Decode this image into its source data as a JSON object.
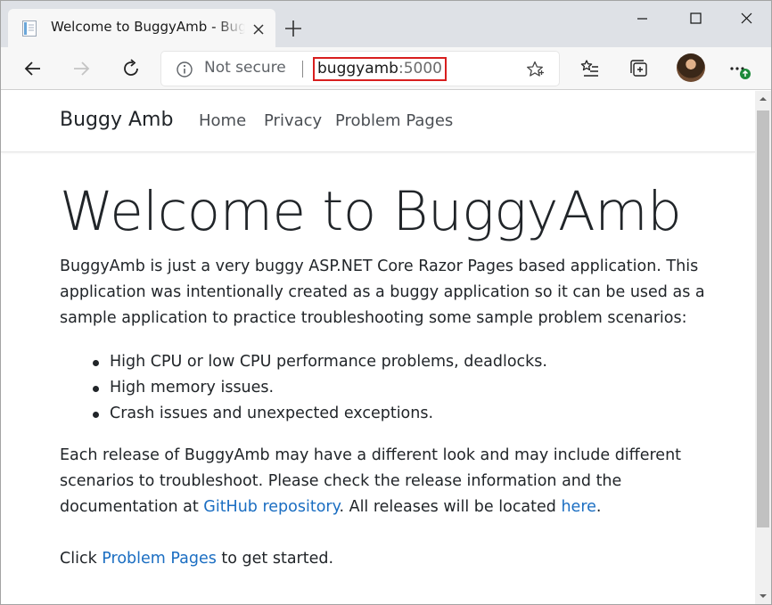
{
  "browser": {
    "tab": {
      "title": "Welcome to BuggyAmb - BuggyAmb"
    },
    "address_bar": {
      "security_label": "Not secure",
      "url_host": "buggyamb",
      "url_port": ":5000"
    },
    "colors": {
      "highlight_box": "#d81e1e",
      "link": "#1b6ec2",
      "update_badge": "#1d8a3a"
    }
  },
  "site": {
    "brand": "Buggy Amb",
    "nav": {
      "home": "Home",
      "privacy": "Privacy",
      "problem_pages": "Problem Pages"
    },
    "hero_title": "Welcome to BuggyAmb",
    "intro": "BuggyAmb is just a very buggy ASP.NET Core Razor Pages based application. This application was intentionally created as a buggy application so it can be used as a sample application to practice troubleshooting some sample problem scenarios:",
    "features": [
      "High CPU or low CPU performance problems, deadlocks.",
      "High memory issues.",
      "Crash issues and unexpected exceptions."
    ],
    "release": {
      "text_before": "Each release of BuggyAmb may have a different look and may include different scenarios to troubleshoot. Please check the release information and the documentation at ",
      "github_link": "GitHub repository",
      "text_middle": ". All releases will be located ",
      "here_link": "here",
      "text_after": "."
    },
    "cta": {
      "text_before": "Click ",
      "link": "Problem Pages",
      "text_after": " to get started."
    }
  }
}
